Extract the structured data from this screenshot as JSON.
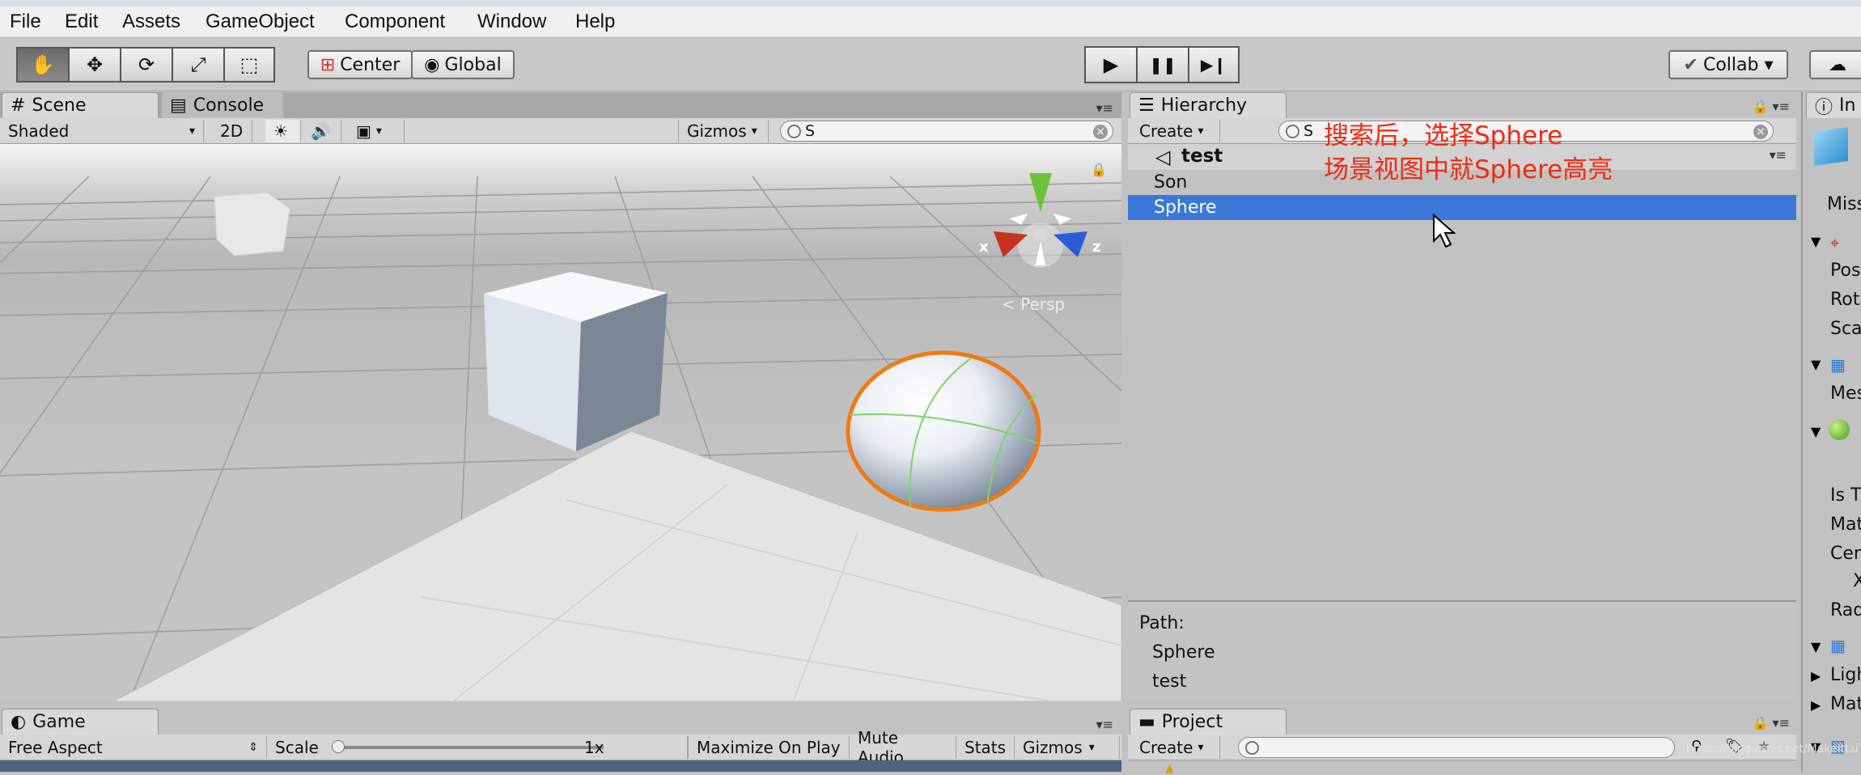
{
  "menu": [
    "File",
    "Edit",
    "Assets",
    "GameObject",
    "Component",
    "Window",
    "Help"
  ],
  "toolbar": {
    "pivot_label": "Center",
    "space_label": "Global",
    "collab_label": "Collab ▾",
    "tools": [
      "hand-tool",
      "move-tool",
      "rotate-tool",
      "scale-tool",
      "rect-tool"
    ],
    "tool_glyphs": [
      "✋",
      "✥",
      "⟳",
      "⤢",
      "⬚"
    ],
    "play_glyph": "▶",
    "pause_glyph": "❚❚",
    "step_glyph": "▶❙"
  },
  "scene": {
    "tab_label": "Scene",
    "console_tab_label": "Console",
    "shading_mode": "Shaded",
    "mode_2d": "2D",
    "gizmos_label": "Gizmos",
    "search_value": "S",
    "persp_label": "Persp",
    "axis_x": "x",
    "axis_z": "z"
  },
  "hierarchy": {
    "tab_label": "Hierarchy",
    "create_label": "Create",
    "search_value": "S",
    "scene_name": "test",
    "items": [
      {
        "label": "Son",
        "selected": false
      },
      {
        "label": "Sphere",
        "selected": true
      }
    ],
    "path_label": "Path:",
    "path_items": [
      "Sphere",
      "test"
    ]
  },
  "annotation": {
    "line1": "搜索后，选择Sphere",
    "line2": "场景视图中就Sphere高亮"
  },
  "inspector": {
    "tab_label": "In",
    "rows": [
      "Miss",
      "Pos",
      "Rota",
      "Sca",
      "Mes",
      "Is T",
      "Mat",
      "Cen",
      "X",
      "Rad",
      "Ligh",
      "Mat"
    ]
  },
  "game": {
    "tab_label": "Game",
    "aspect_label": "Free Aspect",
    "scale_label": "Scale",
    "scale_value": "1x",
    "maximize_label": "Maximize On Play",
    "mute_label": "Mute Audio",
    "stats_label": "Stats",
    "gizmos_label": "Gizmos"
  },
  "project": {
    "tab_label": "Project",
    "create_label": "Create"
  },
  "watermark": "https://blog.csdn.net/MakeItLuTe",
  "colors": {
    "selection": "#3c78d8",
    "annotation": "#f02a12",
    "sphere_outline": "#f07a14"
  }
}
